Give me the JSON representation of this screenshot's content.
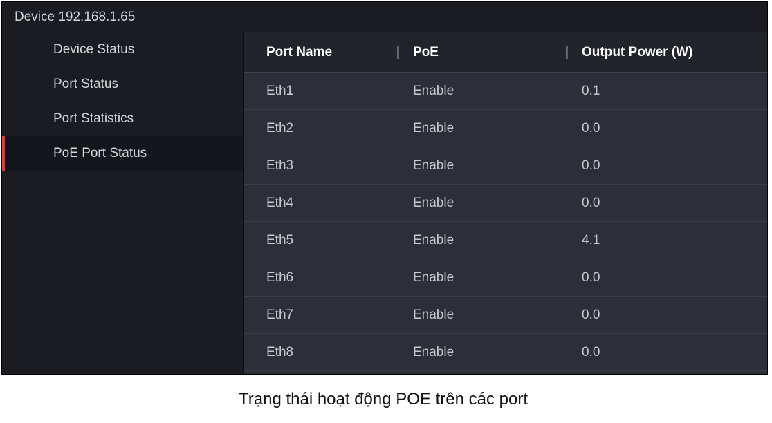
{
  "title": "Device 192.168.1.65",
  "sidebar": {
    "items": [
      {
        "label": "Device Status",
        "active": false
      },
      {
        "label": "Port Status",
        "active": false
      },
      {
        "label": "Port Statistics",
        "active": false
      },
      {
        "label": "PoE Port Status",
        "active": true
      }
    ]
  },
  "table": {
    "headers": {
      "port_name": "Port Name",
      "poe": "PoE",
      "output_power": "Output Power (W)"
    },
    "rows": [
      {
        "port_name": "Eth1",
        "poe": "Enable",
        "output_power": "0.1"
      },
      {
        "port_name": "Eth2",
        "poe": "Enable",
        "output_power": "0.0"
      },
      {
        "port_name": "Eth3",
        "poe": "Enable",
        "output_power": "0.0"
      },
      {
        "port_name": "Eth4",
        "poe": "Enable",
        "output_power": "0.0"
      },
      {
        "port_name": "Eth5",
        "poe": "Enable",
        "output_power": "4.1"
      },
      {
        "port_name": "Eth6",
        "poe": "Enable",
        "output_power": "0.0"
      },
      {
        "port_name": "Eth7",
        "poe": "Enable",
        "output_power": "0.0"
      },
      {
        "port_name": "Eth8",
        "poe": "Enable",
        "output_power": "0.0"
      }
    ]
  },
  "caption": "Trạng thái hoạt động POE trên các port",
  "separator": "|"
}
